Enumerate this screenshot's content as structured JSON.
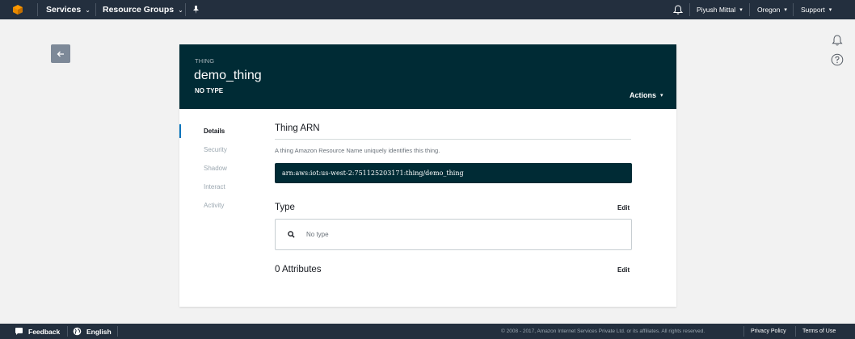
{
  "topbar": {
    "logo_icon": "aws-cube-icon",
    "services_label": "Services",
    "resource_groups_label": "Resource Groups",
    "pin_icon": "pin-icon",
    "bell_icon": "bell-icon",
    "user_label": "Piyush Mittal",
    "region_label": "Oregon",
    "support_label": "Support",
    "caret": "⌄",
    "small_caret": "▾"
  },
  "side": {
    "back_icon": "arrow-left-icon",
    "bell_icon": "bell-icon",
    "help_icon": "help-icon"
  },
  "thing": {
    "kind_label": "THING",
    "name": "demo_thing",
    "type_label": "NO TYPE",
    "actions_label": "Actions",
    "actions_caret": "▾"
  },
  "tabs": [
    {
      "label": "Details",
      "active": true
    },
    {
      "label": "Security",
      "active": false
    },
    {
      "label": "Shadow",
      "active": false
    },
    {
      "label": "Interact",
      "active": false
    },
    {
      "label": "Activity",
      "active": false
    }
  ],
  "details": {
    "arn_title": "Thing ARN",
    "arn_description": "A thing Amazon Resource Name uniquely identifies this thing.",
    "arn_value": "arn:aws:iot:us-west-2:751125203171:thing/demo_thing",
    "type_title": "Type",
    "type_edit_label": "Edit",
    "type_value": "No type",
    "attributes_title": "0  Attributes",
    "attributes_edit_label": "Edit"
  },
  "footer": {
    "feedback_label": "Feedback",
    "english_label": "English",
    "copyright": "© 2008 - 2017, Amazon Internet Services Private Ltd. or its affiliates. All rights reserved.",
    "privacy_label": "Privacy Policy",
    "terms_label": "Terms of Use"
  },
  "colors": {
    "nav_bg": "#232f3e",
    "header_bg": "#002b35",
    "accent": "#0073bb",
    "page_bg": "#f2f2f2"
  }
}
